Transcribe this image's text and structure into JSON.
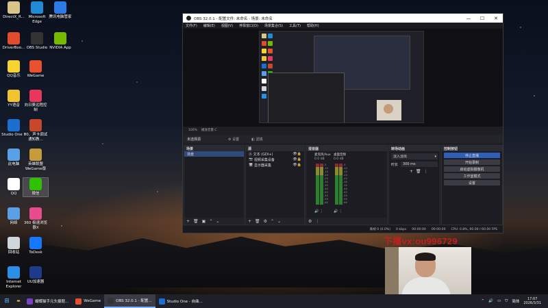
{
  "desktop": {
    "icons": [
      {
        "label": "DirectX_R...",
        "color": "#d8c58a"
      },
      {
        "label": "Microsoft Edge",
        "color": "#1f8ad6"
      },
      {
        "label": "腾讯电脑管家",
        "color": "#2c7be5"
      },
      {
        "label": "DriverBoo...",
        "color": "#e34b2c"
      },
      {
        "label": "OBS Studio",
        "color": "#333333"
      },
      {
        "label": "NVIDIA App",
        "color": "#76b900"
      },
      {
        "label": "QQ音乐",
        "color": "#f6d330"
      },
      {
        "label": "WeGame",
        "color": "#e8502f"
      },
      {
        "label": "YY语音",
        "color": "#f2c230"
      },
      {
        "label": "向日葵远程控制",
        "color": "#e8365d"
      },
      {
        "label": "Studio One 7",
        "color": "#1b6fd1"
      },
      {
        "label": "00、声卡调试通知教...",
        "color": "#c8462c"
      },
      {
        "label": "此电脑",
        "color": "#5aa0e6"
      },
      {
        "label": "英雄联盟WeGame版",
        "color": "#c69b3a"
      },
      {
        "label": "QQ",
        "color": "#ffffff"
      },
      {
        "label": "微信",
        "color": "#2dc100"
      },
      {
        "label": "网络",
        "color": "#5aa0e6"
      },
      {
        "label": "360 极速浏览器X",
        "color": "#e94c8e"
      },
      {
        "label": "回收站",
        "color": "#cfd6dc"
      },
      {
        "label": "ToDesk",
        "color": "#1678ff"
      },
      {
        "label": "Internet Explorer",
        "color": "#2b8ee6"
      },
      {
        "label": "UU加速器",
        "color": "#1e3a8a"
      }
    ]
  },
  "obs": {
    "title": "OBS 32.0.1 - 配置文件: 未命名 - 场景: 未命名",
    "window_controls": [
      "—",
      "☐",
      "✕"
    ],
    "menu": [
      "文件(F)",
      "编辑(E)",
      "视图(V)",
      "停靠窗口(D)",
      "场景集合(S)",
      "工具(T)",
      "帮助(H)"
    ],
    "zoom_row": [
      "100%",
      "播放音量 C"
    ],
    "source_bar": {
      "selected": "未选择源",
      "props": "设置",
      "filters": "滤镜"
    },
    "scenes": {
      "title": "场景",
      "items": [
        "场景"
      ]
    },
    "sources": {
      "title": "源",
      "items": [
        "文本 (GDI+)",
        "视频采集设备",
        "显示器采集"
      ]
    },
    "mixer": {
      "title": "混音器",
      "channels": [
        {
          "name": "麦克风/Aux",
          "db": "0.0 dB"
        },
        {
          "name": "桌面音频",
          "db": "0.0 dB"
        }
      ],
      "scale": [
        "-5",
        "-10",
        "-15",
        "-20",
        "-25",
        "-30",
        "-35",
        "-40",
        "-45",
        "-50",
        "-55",
        "-60"
      ]
    },
    "transitions": {
      "title": "转场动画",
      "select": "淡入淡出",
      "duration_label": "时长",
      "duration": "300 ms"
    },
    "controls": {
      "title": "控制按钮",
      "buttons": [
        "停止直播",
        "开始录制",
        "启动虚拟摄像机",
        "工作室模式",
        "设置"
      ]
    },
    "status": [
      "丢帧 0 (0.0%)",
      "0 kbps",
      "00:00:00",
      "00:00:00",
      "CPU: 0.8%, 60.00 / 60.00 FPS"
    ]
  },
  "overlay": {
    "watermark": "下播vx:ou996729"
  },
  "taskbar": {
    "apps": [
      {
        "label": "蝴蝶猫手元头摄题...",
        "color": "#7a3fc2"
      },
      {
        "label": "WeGame",
        "color": "#e8502f"
      },
      {
        "label": "OBS 32.0.1 - 配置...",
        "color": "#333333"
      },
      {
        "label": "Studio One - 自曲...",
        "color": "#1b6fd1"
      }
    ],
    "tray": {
      "lang": "简体",
      "time": "17:07",
      "date": "2026/3/31"
    }
  }
}
